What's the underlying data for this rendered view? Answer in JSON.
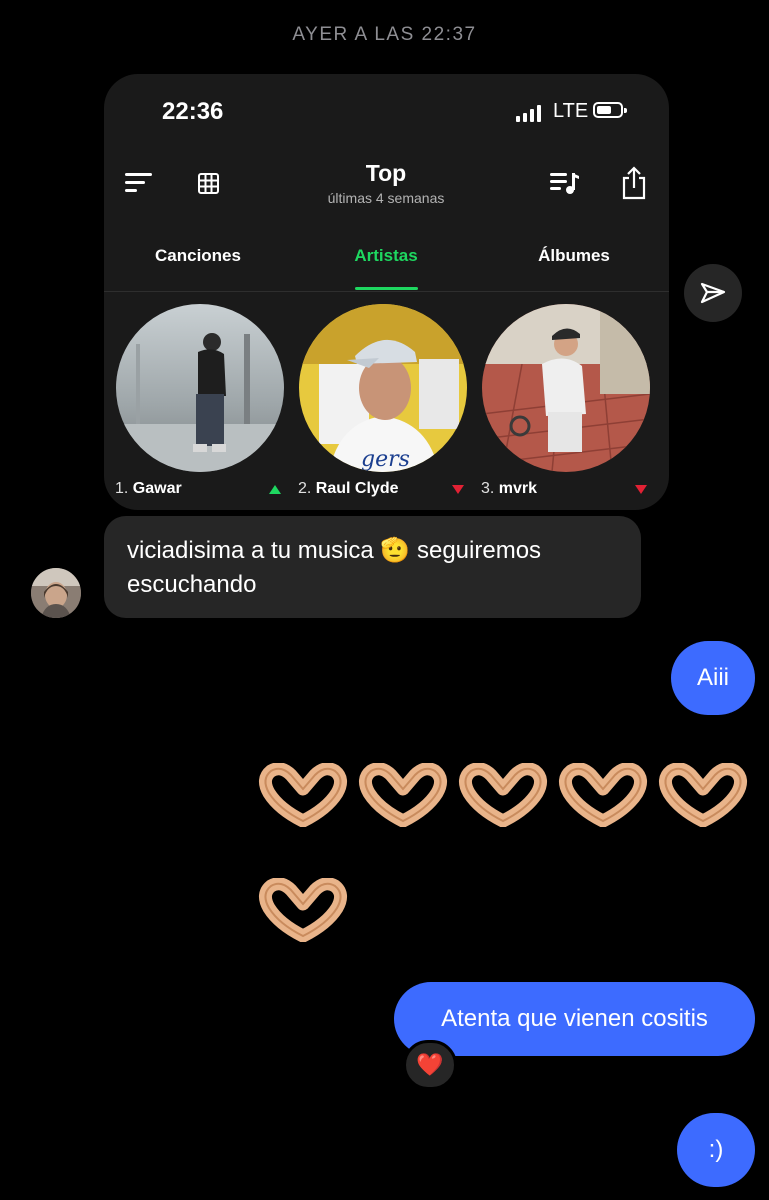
{
  "chat": {
    "timestamp": "AYER A LAS 22:37"
  },
  "shared_screenshot": {
    "status_bar": {
      "time": "22:36",
      "network": "LTE"
    },
    "header": {
      "title": "Top",
      "subtitle": "últimas 4 semanas"
    },
    "tabs": [
      {
        "label": "Canciones",
        "active": false
      },
      {
        "label": "Artistas",
        "active": true
      },
      {
        "label": "Álbumes",
        "active": false
      }
    ],
    "artists": [
      {
        "rank": "1.",
        "name": "Gawar",
        "trend": "up"
      },
      {
        "rank": "2.",
        "name": "Raul Clyde",
        "trend": "down"
      },
      {
        "rank": "3.",
        "name": "mvrk",
        "trend": "down"
      }
    ],
    "icons": [
      "sort-icon",
      "grid-icon",
      "playlist-icon",
      "share-icon"
    ]
  },
  "messages": {
    "incoming": {
      "text_part1": "viciadisima a tu musica",
      "emoji": "🫡",
      "text_part2": "seguiremos escuchando"
    },
    "out1": "Aiii",
    "out2": "Atenta que vienen cositis",
    "out2_reaction": "❤️",
    "out3": ":)"
  },
  "colors": {
    "spotify_green": "#1ed760",
    "trend_down": "#e22134",
    "outgoing_bubble": "#3d6bff",
    "incoming_bubble": "#262626"
  }
}
